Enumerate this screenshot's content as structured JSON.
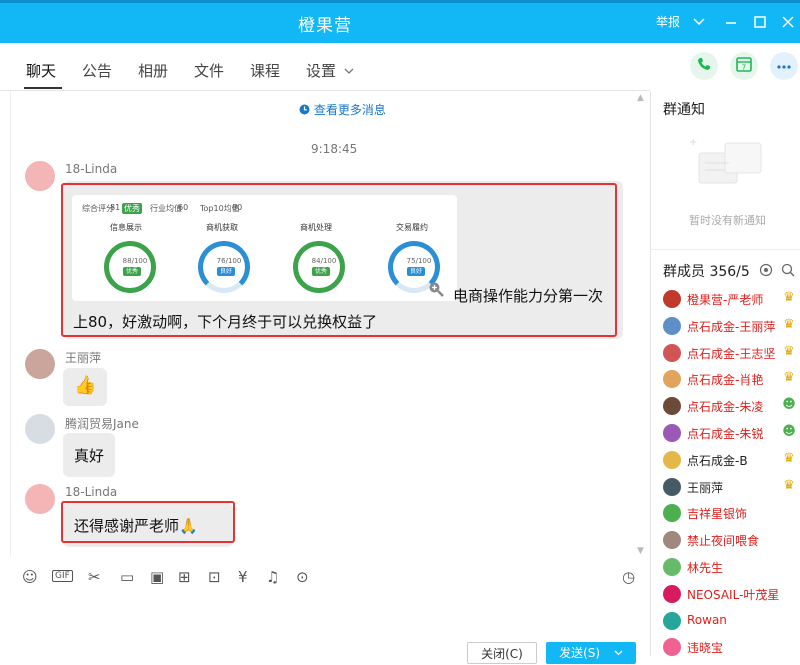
{
  "window": {
    "title": "橙果营",
    "report_label": "举报",
    "colors": {
      "titlebar": "#12b7f5",
      "accent": "#1a78c8"
    }
  },
  "tabs": [
    {
      "label": "聊天"
    },
    {
      "label": "公告"
    },
    {
      "label": "相册"
    },
    {
      "label": "文件"
    },
    {
      "label": "课程"
    },
    {
      "label": "设置"
    }
  ],
  "chat": {
    "load_more": "查看更多消息",
    "timestamp": "9:18:45",
    "messages": [
      {
        "sender": "18-Linda",
        "card": {
          "header": {
            "score_label": "综合评分",
            "score": "81",
            "score_tag": "优秀",
            "industry_label": "行业均值",
            "industry": "60",
            "top10_label": "Top10均值",
            "top10": "80"
          },
          "gauges": [
            {
              "label": "信息展示",
              "value": "88/100",
              "tag": "优秀",
              "level": 0.88
            },
            {
              "label": "商机获取",
              "value": "76/100",
              "tag": "良好",
              "level": 0.76
            },
            {
              "label": "商机处理",
              "value": "84/100",
              "tag": "优秀",
              "level": 0.84
            },
            {
              "label": "交易履约",
              "value": "75/100",
              "tag": "良好",
              "level": 0.75
            }
          ]
        },
        "text_line1": "电商操作能力分第一次",
        "text_line2": "上80，好激动啊，下个月终于可以兑换权益了"
      },
      {
        "sender": "王丽萍",
        "emoji": "👍"
      },
      {
        "sender": "腾润贸易Jane",
        "text": "真好"
      },
      {
        "sender": "18-Linda",
        "text": "还得感谢严老师🙏"
      }
    ]
  },
  "composer": {
    "toolbar": [
      "smile-icon",
      "gif-icon",
      "scissors-icon",
      "folder-icon",
      "image-icon",
      "gift-icon",
      "present-icon",
      "red-packet-icon",
      "bell-icon",
      "more-icon",
      "history-icon"
    ],
    "close_label": "关闭(C)",
    "send_label": "发送(S)"
  },
  "sidebar": {
    "notice_title": "群通知",
    "notice_empty": "暂时没有新通知",
    "members_title": "群成员 356/5",
    "members": [
      {
        "name": "橙果营-严老师",
        "color": "#e0201d",
        "badge": "crown"
      },
      {
        "name": "点石成金-王丽萍",
        "color": "#e0201d",
        "badge": "crown"
      },
      {
        "name": "点石成金-王志坚",
        "color": "#e0201d",
        "badge": "crown"
      },
      {
        "name": "点石成金-肖艳",
        "color": "#e0201d",
        "badge": "crown"
      },
      {
        "name": "点石成金-朱凌",
        "color": "#e0201d",
        "badge": "person"
      },
      {
        "name": "点石成金-朱锐",
        "color": "#e0201d",
        "badge": "person"
      },
      {
        "name": "点石成金-B",
        "color": "#222222",
        "badge": "crown"
      },
      {
        "name": "王丽萍",
        "color": "#222222",
        "badge": "crown"
      },
      {
        "name": "吉祥星银饰",
        "color": "#e0201d",
        "badge": ""
      },
      {
        "name": "禁止夜间喂食",
        "color": "#e0201d",
        "badge": ""
      },
      {
        "name": "林先生",
        "color": "#e0201d",
        "badge": ""
      },
      {
        "name": "NEOSAIL-叶茂星",
        "color": "#e0201d",
        "badge": ""
      },
      {
        "name": "Rowan",
        "color": "#e0201d",
        "badge": ""
      },
      {
        "name": "违晓宝",
        "color": "#e0201d",
        "badge": ""
      }
    ]
  }
}
